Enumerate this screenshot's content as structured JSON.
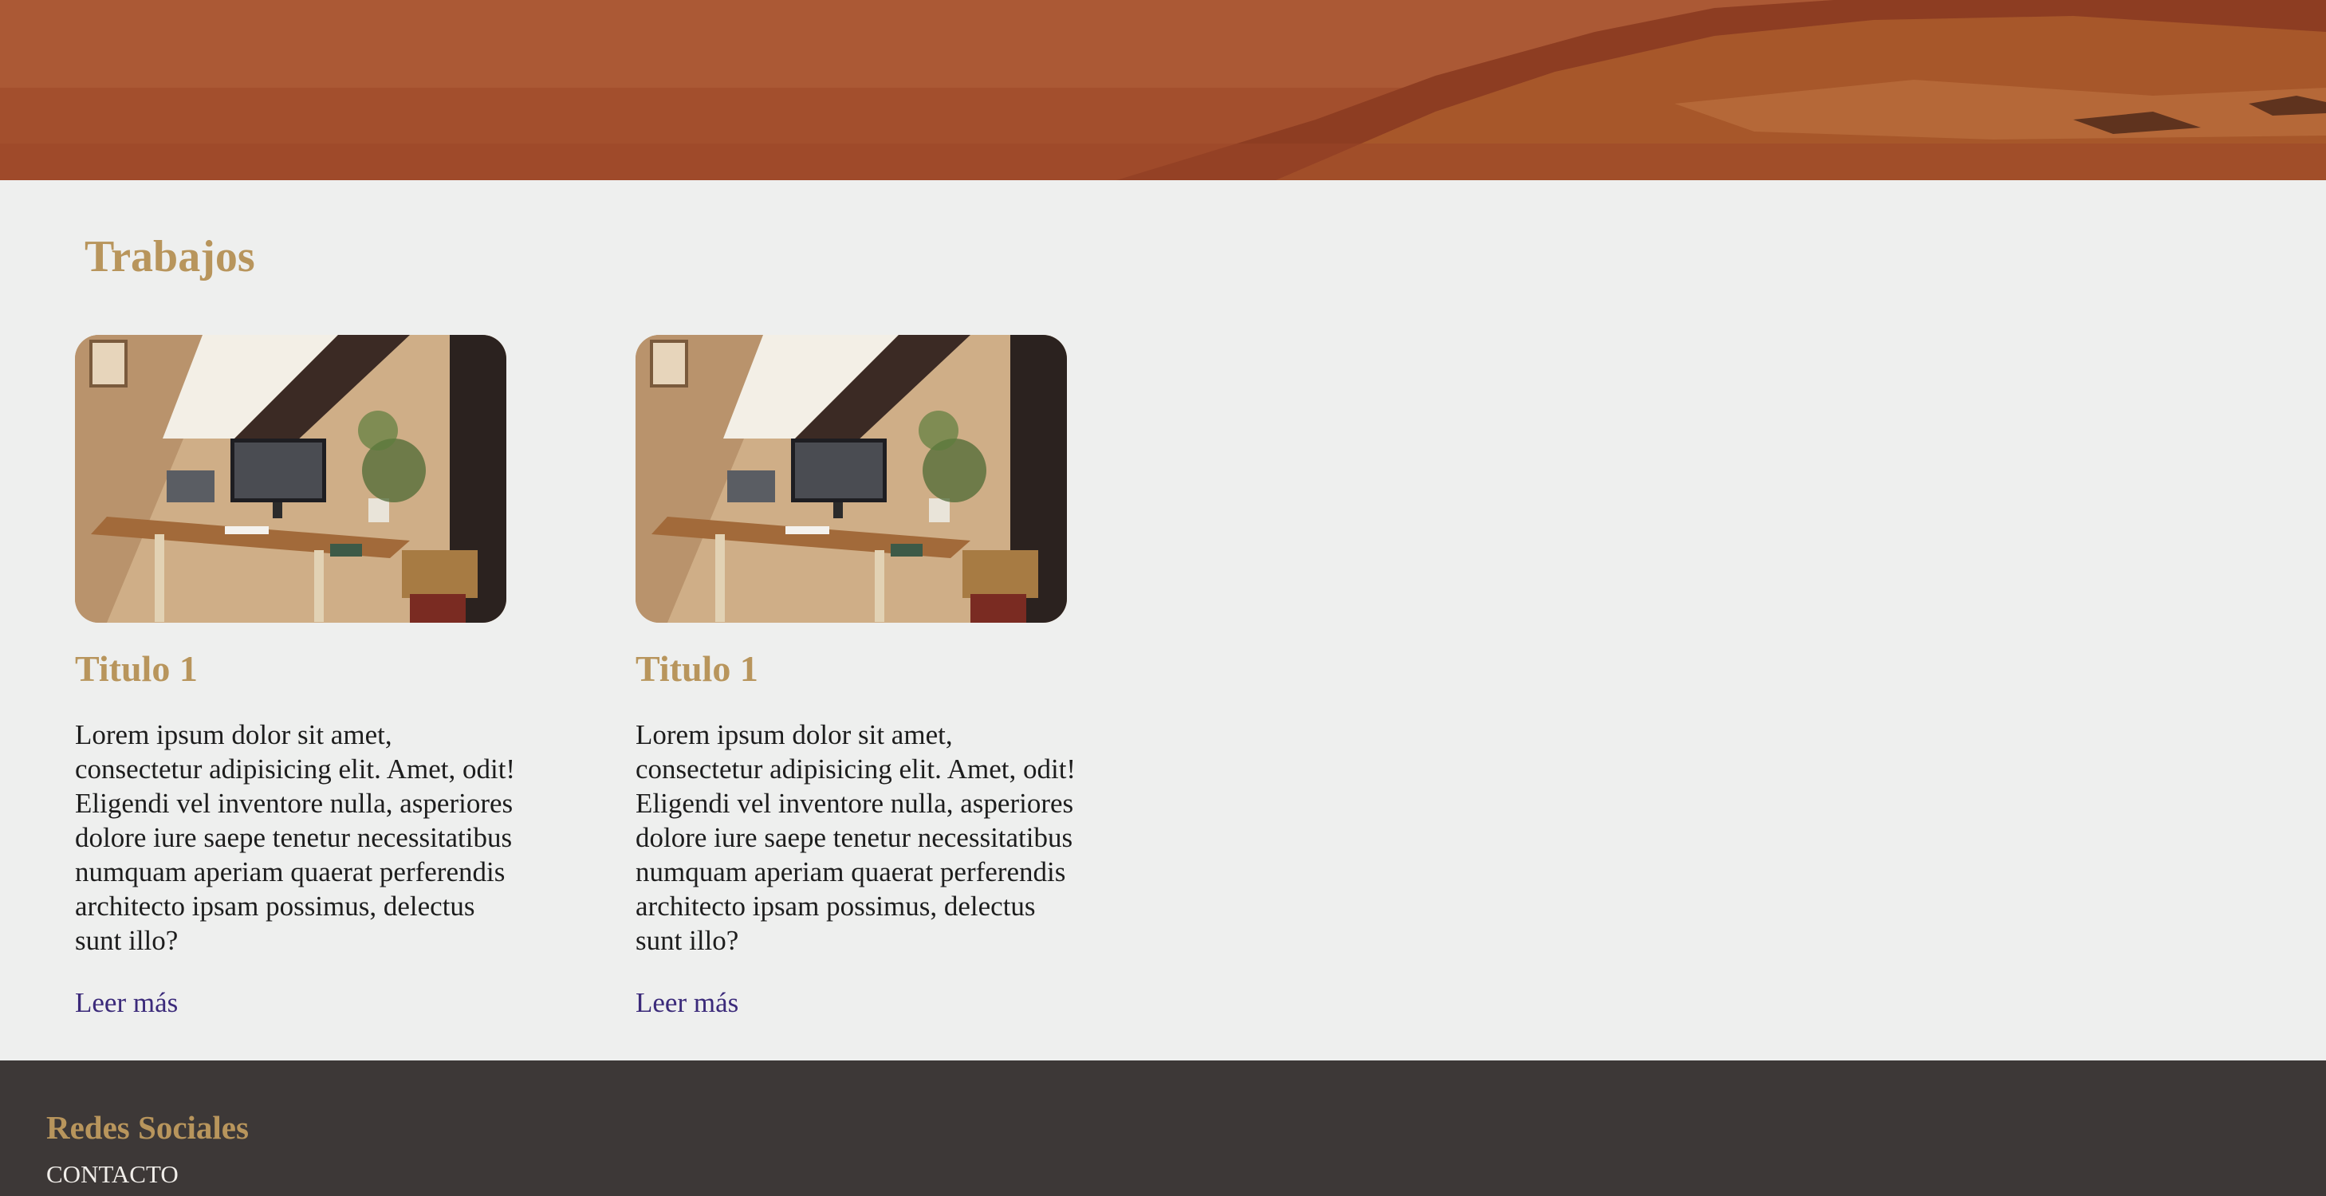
{
  "main": {
    "section_title": "Trabajos",
    "cards": [
      {
        "title": "Titulo 1",
        "text": "Lorem ipsum dolor sit amet, consectetur adipisicing elit. Amet, odit! Eligendi vel inventore nulla, asperiores dolore iure saepe tenetur necessitatibus numquam aperiam quaerat perferendis architecto ipsam possimus, delectus sunt illo?",
        "link": "Leer más"
      },
      {
        "title": "Titulo 1",
        "text": "Lorem ipsum dolor sit amet, consectetur adipisicing elit. Amet, odit! Eligendi vel inventore nulla, asperiores dolore iure saepe tenetur necessitatibus numquam aperiam quaerat perferendis architecto ipsam possimus, delectus sunt illo?",
        "link": "Leer más"
      }
    ]
  },
  "footer": {
    "title": "Redes Sociales",
    "contact_link": "CONTACTO"
  },
  "colors": {
    "accent": "#b8955c",
    "background": "#eeefee",
    "footer_bg": "#3d3837",
    "link": "#3b2a7a",
    "text": "#1d1d1d"
  }
}
